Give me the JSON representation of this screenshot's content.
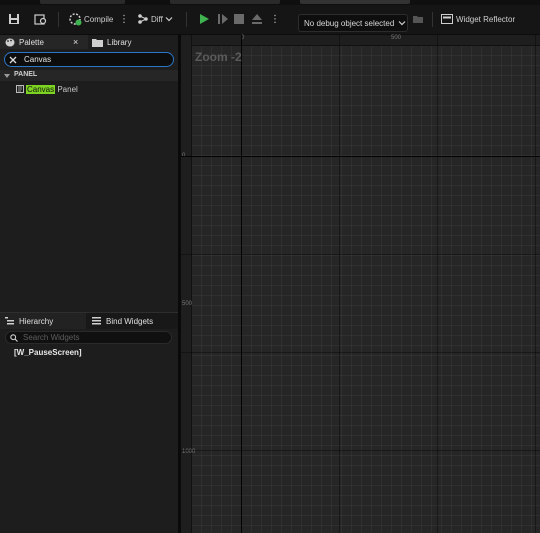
{
  "toolbar": {
    "compile_label": "Compile",
    "diff_label": "Diff",
    "debug_dropdown": "No debug object selected",
    "widget_reflector_label": "Widget Reflector"
  },
  "palette": {
    "tab_label": "Palette",
    "close_glyph": "×",
    "library_tab_label": "Library",
    "search_value": "Canvas",
    "category_label": "PANEL",
    "item_highlight": "Canvas",
    "item_rest": " Panel"
  },
  "hierarchy": {
    "tab_label": "Hierarchy",
    "bind_tab_label": "Bind Widgets",
    "search_placeholder": "Search Widgets",
    "root_item": "[W_PauseScreen]"
  },
  "designer": {
    "zoom_label": "Zoom -2",
    "ruler_top_labels": [
      "0",
      "500"
    ],
    "ruler_left_labels": [
      "0",
      "500",
      "1000"
    ]
  },
  "colors": {
    "accent_blue": "#2b77c9",
    "highlight_green": "#7dd321",
    "play_green": "#3fb34f"
  }
}
